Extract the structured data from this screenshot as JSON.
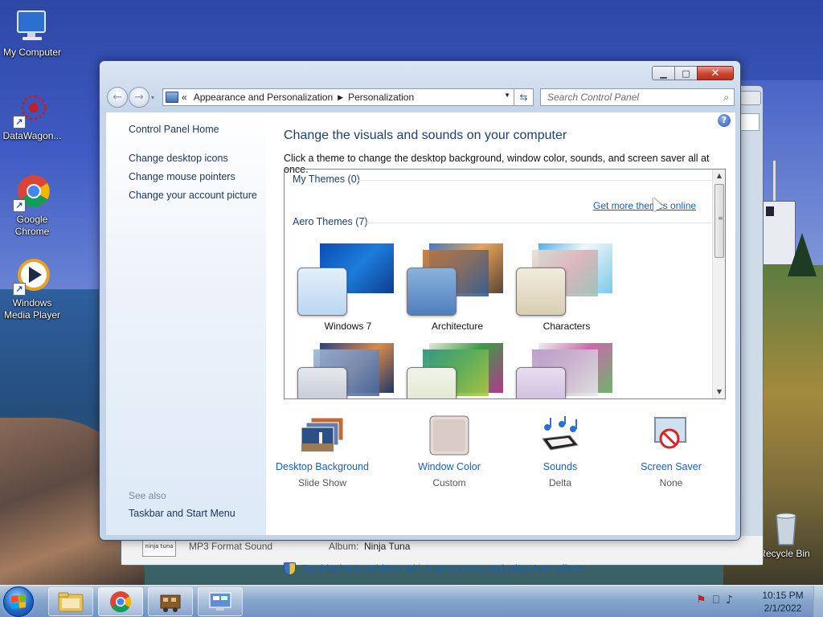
{
  "desktop": {
    "icons": [
      {
        "label": "My Computer"
      },
      {
        "label": "DataWagon..."
      },
      {
        "label": "Google Chrome"
      },
      {
        "label": "Windows Media Player"
      },
      {
        "label": "Recycle Bin"
      }
    ]
  },
  "background_window": {
    "format_label": "MP3 Format Sound",
    "album_label": "Album:",
    "album_value": "Ninja Tuna",
    "album_art_text": "ninja tuna"
  },
  "window": {
    "controls": {
      "minimize": "▁",
      "maximize": "□",
      "close": "✕"
    },
    "nav": {
      "back_icon": "←",
      "forward_icon": "→",
      "history_icon": "▾",
      "breadcrumb_prefix": "«",
      "breadcrumb": [
        "Appearance and Personalization",
        "Personalization"
      ],
      "breadcrumb_sep": "▶",
      "dropdown_icon": "▼",
      "refresh_icon": "⇆",
      "search_placeholder": "Search Control Panel",
      "search_icon": "⌕"
    },
    "sidebar": {
      "home": "Control Panel Home",
      "links": [
        "Change desktop icons",
        "Change mouse pointers",
        "Change your account picture"
      ],
      "see_also_label": "See also",
      "see_also_links": [
        "Taskbar and Start Menu"
      ]
    },
    "main": {
      "help_icon": "?",
      "title": "Change the visuals and sounds on your computer",
      "subtitle": "Click a theme to change the desktop background, window color, sounds, and screen saver all at once.",
      "my_themes_label": "My Themes (0)",
      "get_more_online": "Get more themes online",
      "aero_themes_label": "Aero Themes (7)",
      "themes": [
        {
          "name": "Windows 7",
          "selected": false
        },
        {
          "name": "Architecture",
          "selected": false
        },
        {
          "name": "Characters",
          "selected": false
        },
        {
          "name": "",
          "selected": false
        },
        {
          "name": "",
          "selected": false
        },
        {
          "name": "",
          "selected": false
        }
      ],
      "scroll": {
        "up": "▲",
        "down": "▼",
        "grip": "≡"
      },
      "settings": [
        {
          "label": "Desktop Background",
          "value": "Slide Show"
        },
        {
          "label": "Window Color",
          "value": "Custom"
        },
        {
          "label": "Sounds",
          "value": "Delta"
        },
        {
          "label": "Screen Saver",
          "value": "None"
        }
      ],
      "troubleshoot": "Troubleshoot problems with transparency and other Aero effects"
    }
  },
  "taskbar": {
    "pinned": [
      "windows-explorer",
      "google-chrome",
      "datawagon",
      "control-panel"
    ],
    "tray_icons": {
      "flag": "⚑",
      "network": "⎕",
      "volume": "♪"
    },
    "time": "10:15 PM",
    "date": "2/1/2022"
  },
  "colors": {
    "link": "#1a5fb4",
    "heading": "#1f3f6e",
    "close_button": "#c94431"
  }
}
